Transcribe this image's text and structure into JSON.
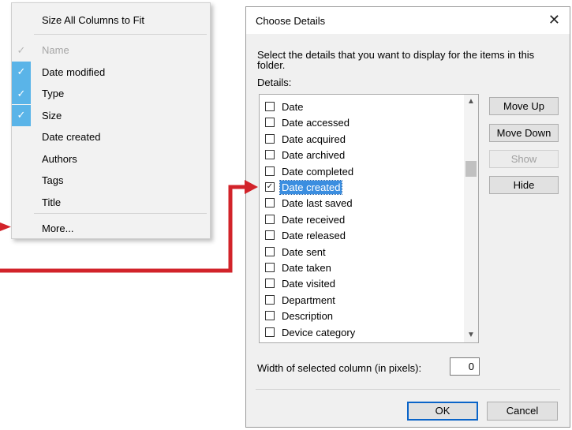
{
  "context_menu": {
    "size_all": "Size All Columns to Fit",
    "items": [
      {
        "label": "Name",
        "check": "dim",
        "disabled": true
      },
      {
        "label": "Date modified",
        "check": "on",
        "disabled": false
      },
      {
        "label": "Type",
        "check": "on",
        "disabled": false
      },
      {
        "label": "Size",
        "check": "on",
        "disabled": false
      },
      {
        "label": "Date created",
        "check": "none",
        "disabled": false
      },
      {
        "label": "Authors",
        "check": "none",
        "disabled": false
      },
      {
        "label": "Tags",
        "check": "none",
        "disabled": false
      },
      {
        "label": "Title",
        "check": "none",
        "disabled": false
      }
    ],
    "more": "More...",
    "check_glyph": "✓"
  },
  "dialog": {
    "title": "Choose Details",
    "close_glyph": "✕",
    "instructions": "Select the details that you want to display for the items in this folder.",
    "details_label": "Details:",
    "items": [
      {
        "label": "Date",
        "checked": false
      },
      {
        "label": "Date accessed",
        "checked": false
      },
      {
        "label": "Date acquired",
        "checked": false
      },
      {
        "label": "Date archived",
        "checked": false
      },
      {
        "label": "Date completed",
        "checked": false
      },
      {
        "label": "Date created",
        "checked": true,
        "selected": true
      },
      {
        "label": "Date last saved",
        "checked": false
      },
      {
        "label": "Date received",
        "checked": false
      },
      {
        "label": "Date released",
        "checked": false
      },
      {
        "label": "Date sent",
        "checked": false
      },
      {
        "label": "Date taken",
        "checked": false
      },
      {
        "label": "Date visited",
        "checked": false
      },
      {
        "label": "Department",
        "checked": false
      },
      {
        "label": "Description",
        "checked": false
      },
      {
        "label": "Device category",
        "checked": false
      }
    ],
    "buttons": {
      "move_up": "Move Up",
      "move_down": "Move Down",
      "show": "Show",
      "hide": "Hide"
    },
    "width_label": "Width of selected column (in pixels):",
    "width_value": "0",
    "ok": "OK",
    "cancel": "Cancel"
  },
  "colors": {
    "check_highlight": "#5ab4e8",
    "selection": "#3b8ee0",
    "arrow": "#d2232a"
  }
}
